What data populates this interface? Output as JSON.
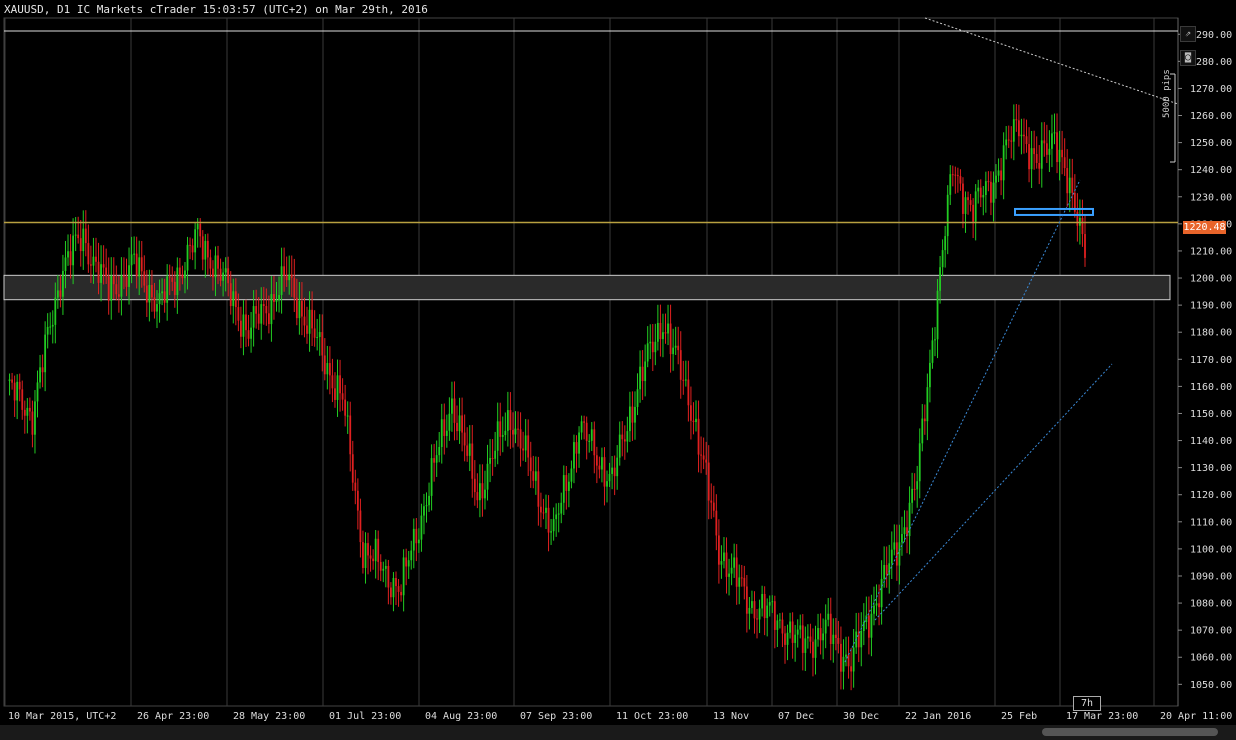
{
  "header": {
    "title": "XAUUSD, D1 IC Markets cTrader 15:03:57 (UTC+2) on Mar 29th, 2016"
  },
  "toolbar": {
    "popout_icon": "popout-icon",
    "camera_icon": "camera-icon"
  },
  "price_axis": {
    "labels": [
      "1290.00",
      "1280.00",
      "1270.00",
      "1260.00",
      "1250.00",
      "1240.00",
      "1230.00",
      "1220.00",
      "1210.00",
      "1200.00",
      "1190.00",
      "1180.00",
      "1170.00",
      "1160.00",
      "1150.00",
      "1140.00",
      "1130.00",
      "1120.00",
      "1110.00",
      "1100.00",
      "1090.00",
      "1080.00",
      "1070.00",
      "1060.00",
      "1050.00"
    ],
    "current_price": "1220.48",
    "range": [
      1045,
      1300
    ]
  },
  "time_axis": {
    "labels": [
      "10 Mar 2015, UTC+2",
      "26 Apr 23:00",
      "28 May 23:00",
      "01 Jul 23:00",
      "04 Aug 23:00",
      "07 Sep 23:00",
      "11 Oct 23:00",
      "13 Nov",
      "07 Dec",
      "30 Dec",
      "22 Jan 2016",
      "25 Feb",
      "17 Mar 23:00",
      "20 Apr 11:00"
    ]
  },
  "measure": {
    "label": "5000 pips"
  },
  "timer": {
    "label": "7h"
  },
  "colors": {
    "bull": "#22cc22",
    "bear": "#e02020",
    "price_line": "#b8a040",
    "price_tag": "#e8642a",
    "trend": "#3a8ad8",
    "zone": "#2a2a2a"
  },
  "chart_data": {
    "type": "candlestick",
    "symbol": "XAUUSD",
    "timeframe": "D1",
    "ylim": [
      1045,
      1300
    ],
    "key_path": [
      [
        0,
        1160
      ],
      [
        10,
        1150
      ],
      [
        22,
        1205
      ],
      [
        30,
        1215
      ],
      [
        40,
        1195
      ],
      [
        50,
        1205
      ],
      [
        60,
        1190
      ],
      [
        75,
        1215
      ],
      [
        82,
        1205
      ],
      [
        95,
        1180
      ],
      [
        110,
        1200
      ],
      [
        120,
        1180
      ],
      [
        132,
        1155
      ],
      [
        140,
        1100
      ],
      [
        155,
        1085
      ],
      [
        168,
        1130
      ],
      [
        175,
        1155
      ],
      [
        185,
        1120
      ],
      [
        198,
        1150
      ],
      [
        215,
        1105
      ],
      [
        225,
        1145
      ],
      [
        238,
        1125
      ],
      [
        248,
        1160
      ],
      [
        258,
        1185
      ],
      [
        270,
        1150
      ],
      [
        280,
        1100
      ],
      [
        292,
        1080
      ],
      [
        302,
        1075
      ],
      [
        312,
        1065
      ],
      [
        322,
        1070
      ],
      [
        332,
        1058
      ],
      [
        342,
        1082
      ],
      [
        350,
        1100
      ],
      [
        358,
        1125
      ],
      [
        366,
        1195
      ],
      [
        372,
        1240
      ],
      [
        380,
        1225
      ],
      [
        390,
        1240
      ],
      [
        398,
        1258
      ],
      [
        405,
        1240
      ],
      [
        412,
        1255
      ],
      [
        418,
        1230
      ],
      [
        424,
        1215
      ]
    ],
    "current": 1220.48
  }
}
